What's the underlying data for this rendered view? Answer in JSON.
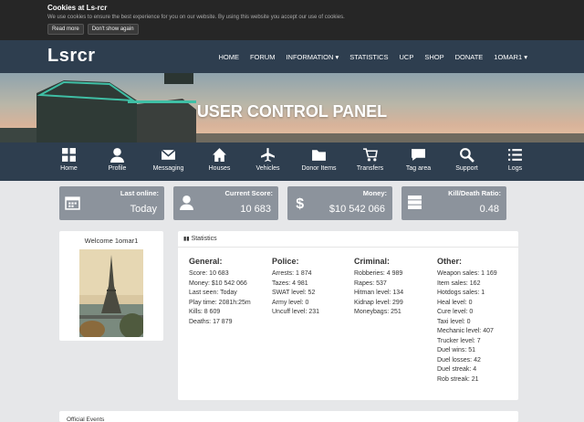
{
  "cookie": {
    "title": "Cookies at Ls-rcr",
    "message": "We use cookies to ensure the best experience for you on our website. By using this website you accept our use of cookies.",
    "read_more": "Read more",
    "dont_show": "Don't show again"
  },
  "brand": {
    "logo": "Lsrcr"
  },
  "menu": [
    "HOME",
    "FORUM",
    "INFORMATION ▾",
    "STATISTICS",
    "UCP",
    "SHOP",
    "DONATE",
    "1OMAR1 ▾"
  ],
  "banner": {
    "title": "USER CONTROL PANEL"
  },
  "iconbar": [
    {
      "label": "Home",
      "icon": "grid-icon"
    },
    {
      "label": "Profile",
      "icon": "user-icon"
    },
    {
      "label": "Messaging",
      "icon": "envelope-icon"
    },
    {
      "label": "Houses",
      "icon": "house-icon"
    },
    {
      "label": "Vehicles",
      "icon": "plane-icon"
    },
    {
      "label": "Donor Items",
      "icon": "folder-icon"
    },
    {
      "label": "Transfers",
      "icon": "cart-icon"
    },
    {
      "label": "Tag area",
      "icon": "comment-icon"
    },
    {
      "label": "Support",
      "icon": "search-icon"
    },
    {
      "label": "Logs",
      "icon": "list-icon"
    }
  ],
  "stats": [
    {
      "label": "Last online:",
      "value": "Today",
      "icon": "calendar-icon"
    },
    {
      "label": "Current Score:",
      "value": "10 683",
      "icon": "user-icon"
    },
    {
      "label": "Money:",
      "value": "$10 542 066",
      "icon": "dollar-icon"
    },
    {
      "label": "Kill/Death Ratio:",
      "value": "0.48",
      "icon": "server-icon"
    }
  ],
  "welcome": {
    "text": "Welcome 1omar1"
  },
  "statistics": {
    "header": "Statistics",
    "general": {
      "title": "General:",
      "rows": [
        "Score: 10 683",
        "Money: $10 542 066",
        "Last seen: Today",
        "Play time: 2081h:25m",
        "Kills: 8 609",
        "Deaths: 17 879"
      ]
    },
    "police": {
      "title": "Police:",
      "rows": [
        "Arrests: 1 874",
        "Tazes: 4 981",
        "SWAT level: 52",
        "Army level: 0",
        "Uncuff level: 231"
      ]
    },
    "criminal": {
      "title": "Criminal:",
      "rows": [
        "Robberies: 4 989",
        "Rapes: 537",
        "Hitman level: 134",
        "Kidnap level: 299",
        "Moneybags: 251"
      ]
    },
    "other": {
      "title": "Other:",
      "rows": [
        "Weapon sales: 1 169",
        "Item sales: 162",
        "Hotdogs sales: 1",
        "Heal level: 0",
        "Cure level: 0",
        "Taxi level: 0",
        "Mechanic level: 407",
        "Trucker level: 7",
        "Duel wins: 51",
        "Duel losses: 42",
        "Duel streak: 4",
        "Rob streak: 21"
      ]
    }
  },
  "events": {
    "title": "Official Events"
  }
}
